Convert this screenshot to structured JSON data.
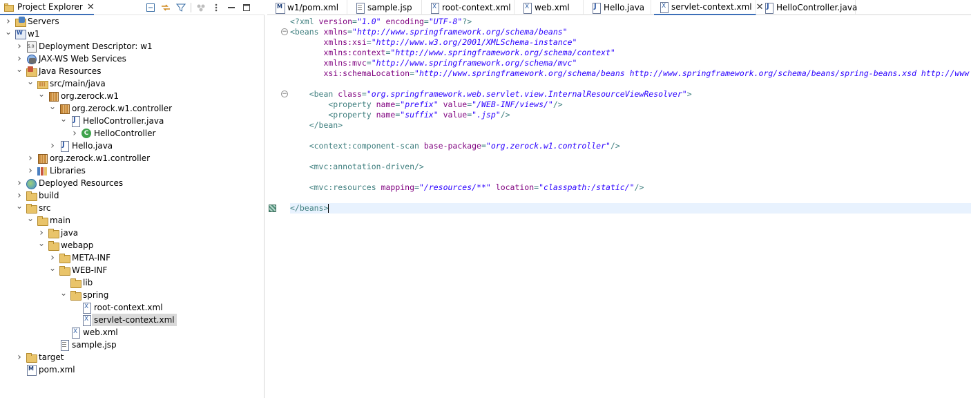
{
  "explorer": {
    "title": "Project Explorer",
    "tree": [
      {
        "label": "Servers",
        "icon": "servers-icon",
        "depth": 0,
        "twisty": "collapsed"
      },
      {
        "label": "w1",
        "icon": "web-project-icon",
        "depth": 0,
        "twisty": "expanded"
      },
      {
        "label": "Deployment Descriptor: w1",
        "icon": "deployment-descriptor-icon",
        "depth": 1,
        "twisty": "collapsed"
      },
      {
        "label": "JAX-WS Web Services",
        "icon": "web-services-icon",
        "depth": 1,
        "twisty": "collapsed"
      },
      {
        "label": "Java Resources",
        "icon": "java-resources-icon",
        "depth": 1,
        "twisty": "expanded"
      },
      {
        "label": "src/main/java",
        "icon": "source-folder-icon",
        "depth": 2,
        "twisty": "expanded"
      },
      {
        "label": "org.zerock.w1",
        "icon": "package-icon",
        "depth": 3,
        "twisty": "expanded"
      },
      {
        "label": "org.zerock.w1.controller",
        "icon": "package-icon",
        "depth": 4,
        "twisty": "expanded"
      },
      {
        "label": "HelloController.java",
        "icon": "java-file-icon",
        "depth": 5,
        "twisty": "expanded"
      },
      {
        "label": "HelloController",
        "icon": "class-icon",
        "depth": 6,
        "twisty": "collapsed"
      },
      {
        "label": "Hello.java",
        "icon": "java-file-icon",
        "depth": 4,
        "twisty": "collapsed"
      },
      {
        "label": "org.zerock.w1.controller",
        "icon": "package-icon",
        "depth": 2,
        "twisty": "collapsed"
      },
      {
        "label": "Libraries",
        "icon": "libraries-icon",
        "depth": 2,
        "twisty": "collapsed"
      },
      {
        "label": "Deployed Resources",
        "icon": "deployed-resources-icon",
        "depth": 1,
        "twisty": "collapsed"
      },
      {
        "label": "build",
        "icon": "folder-icon",
        "depth": 1,
        "twisty": "collapsed"
      },
      {
        "label": "src",
        "icon": "folder-icon",
        "depth": 1,
        "twisty": "expanded"
      },
      {
        "label": "main",
        "icon": "folder-icon",
        "depth": 2,
        "twisty": "expanded"
      },
      {
        "label": "java",
        "icon": "folder-icon",
        "depth": 3,
        "twisty": "collapsed"
      },
      {
        "label": "webapp",
        "icon": "folder-icon",
        "depth": 3,
        "twisty": "expanded"
      },
      {
        "label": "META-INF",
        "icon": "folder-icon",
        "depth": 4,
        "twisty": "collapsed"
      },
      {
        "label": "WEB-INF",
        "icon": "folder-icon",
        "depth": 4,
        "twisty": "expanded"
      },
      {
        "label": "lib",
        "icon": "folder-icon",
        "depth": 5,
        "twisty": "none"
      },
      {
        "label": "spring",
        "icon": "folder-icon",
        "depth": 5,
        "twisty": "expanded"
      },
      {
        "label": "root-context.xml",
        "icon": "xml-file-icon",
        "depth": 6,
        "twisty": "none"
      },
      {
        "label": "servlet-context.xml",
        "icon": "xml-file-icon",
        "depth": 6,
        "twisty": "none",
        "selected": true
      },
      {
        "label": "web.xml",
        "icon": "xml-file-icon",
        "depth": 5,
        "twisty": "none"
      },
      {
        "label": "sample.jsp",
        "icon": "jsp-file-icon",
        "depth": 4,
        "twisty": "none"
      },
      {
        "label": "target",
        "icon": "folder-icon",
        "depth": 1,
        "twisty": "collapsed"
      },
      {
        "label": "pom.xml",
        "icon": "pom-file-icon",
        "depth": 1,
        "twisty": "none"
      }
    ]
  },
  "editor": {
    "tabs": [
      {
        "label": "w1/pom.xml",
        "icon": "pom-file-icon"
      },
      {
        "label": "sample.jsp",
        "icon": "jsp-file-icon"
      },
      {
        "label": "root-context.xml",
        "icon": "xml-file-icon"
      },
      {
        "label": "web.xml",
        "icon": "xml-file-icon"
      },
      {
        "label": "Hello.java",
        "icon": "java-file-icon"
      },
      {
        "label": "servlet-context.xml",
        "icon": "xml-file-icon",
        "active": true
      },
      {
        "label": "HelloController.java",
        "icon": "java-file-icon"
      }
    ],
    "code_lines": [
      [
        [
          "pi",
          "<?xml "
        ],
        [
          "at",
          "version"
        ],
        [
          "tg",
          "="
        ],
        [
          "vl",
          "\"1.0\""
        ],
        [
          "tg",
          " "
        ],
        [
          "at",
          "encoding"
        ],
        [
          "tg",
          "="
        ],
        [
          "vl",
          "\"UTF-8\""
        ],
        [
          "pi",
          "?>"
        ]
      ],
      [
        [
          "tg",
          "<beans "
        ],
        [
          "at",
          "xmlns"
        ],
        [
          "tg",
          "="
        ],
        [
          "vl",
          "\"http://www.springframework.org/schema/beans\""
        ]
      ],
      [
        [
          "tg",
          "       "
        ],
        [
          "at",
          "xmlns:xsi"
        ],
        [
          "tg",
          "="
        ],
        [
          "vl",
          "\"http://www.w3.org/2001/XMLSchema-instance\""
        ]
      ],
      [
        [
          "tg",
          "       "
        ],
        [
          "at",
          "xmlns:context"
        ],
        [
          "tg",
          "="
        ],
        [
          "vl",
          "\"http://www.springframework.org/schema/context\""
        ]
      ],
      [
        [
          "tg",
          "       "
        ],
        [
          "at",
          "xmlns:mvc"
        ],
        [
          "tg",
          "="
        ],
        [
          "vl",
          "\"http://www.springframework.org/schema/mvc\""
        ]
      ],
      [
        [
          "tg",
          "       "
        ],
        [
          "at",
          "xsi:schemaLocation"
        ],
        [
          "tg",
          "="
        ],
        [
          "vl",
          "\"http://www.springframework.org/schema/beans http://www.springframework.org/schema/beans/spring-beans.xsd http://www"
        ]
      ],
      [],
      [
        [
          "tg",
          "    <bean "
        ],
        [
          "at",
          "class"
        ],
        [
          "tg",
          "="
        ],
        [
          "vl",
          "\"org.springframework.web.servlet.view.InternalResourceViewResolver\""
        ],
        [
          "tg",
          ">"
        ]
      ],
      [
        [
          "tg",
          "        <property "
        ],
        [
          "at",
          "name"
        ],
        [
          "tg",
          "="
        ],
        [
          "vl",
          "\"prefix\""
        ],
        [
          "tg",
          " "
        ],
        [
          "at",
          "value"
        ],
        [
          "tg",
          "="
        ],
        [
          "vl",
          "\"/WEB-INF/views/\""
        ],
        [
          "tg",
          "/>"
        ]
      ],
      [
        [
          "tg",
          "        <property "
        ],
        [
          "at",
          "name"
        ],
        [
          "tg",
          "="
        ],
        [
          "vl",
          "\"suffix\""
        ],
        [
          "tg",
          " "
        ],
        [
          "at",
          "value"
        ],
        [
          "tg",
          "="
        ],
        [
          "vl",
          "\".jsp\""
        ],
        [
          "tg",
          "/>"
        ]
      ],
      [
        [
          "tg",
          "    </bean>"
        ]
      ],
      [],
      [
        [
          "tg",
          "    <context:component-scan "
        ],
        [
          "at",
          "base-package"
        ],
        [
          "tg",
          "="
        ],
        [
          "vl",
          "\"org.zerock.w1.controller\""
        ],
        [
          "tg",
          "/>"
        ]
      ],
      [],
      [
        [
          "tg",
          "    <mvc:annotation-driven/>"
        ]
      ],
      [],
      [
        [
          "tg",
          "    <mvc:resources "
        ],
        [
          "at",
          "mapping"
        ],
        [
          "tg",
          "="
        ],
        [
          "vl",
          "\"/resources/**\""
        ],
        [
          "tg",
          " "
        ],
        [
          "at",
          "location"
        ],
        [
          "tg",
          "="
        ],
        [
          "vl",
          "\"classpath:/static/\""
        ],
        [
          "tg",
          "/>"
        ]
      ],
      [],
      [
        [
          "tg",
          "</beans>"
        ]
      ]
    ],
    "current_line": 19,
    "fold_lines": [
      2,
      8
    ]
  },
  "colors": {
    "tag": "#3f7f7f",
    "attribute": "#7f007f",
    "value": "#2a00ff",
    "current_line": "#e8f2fe",
    "active_tab_border": "#3d6fb8"
  }
}
